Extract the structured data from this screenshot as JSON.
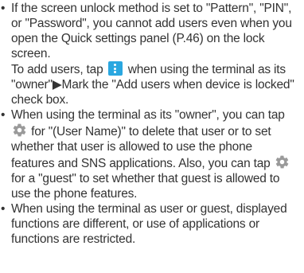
{
  "colors": {
    "text": "#333333",
    "menu_icon_bg": "#2aa7e0",
    "gear_icon": "#9a9a9a"
  },
  "bullets": [
    {
      "lines": [
        "If the screen unlock method is set to \"Pattern\", \"PIN\",",
        "or \"Password\", you cannot add users even when you",
        "open the Quick settings panel (P.46) on the lock",
        "screen."
      ],
      "line5_before": "To add users, tap",
      "line5_after": "when using the terminal as its",
      "lines_after": [
        "\"owner\"▶Mark the \"Add users when device is locked\"",
        "check box."
      ]
    },
    {
      "line1": "When using the terminal as its \"owner\", you can tap",
      "line2_after": "for \"(User Name)\" to delete that user or to set",
      "lines_mid": [
        "whether that user is allowed to use the phone",
        "features and SNS applications. Also, you can tap"
      ],
      "line5_after": "for a \"guest\" to set whether that guest is allowed to",
      "line6": "use the phone features."
    },
    {
      "lines": [
        "When using the terminal as  user or guest, displayed",
        "functions are different, or use of applications or",
        "functions are restricted."
      ]
    }
  ],
  "icons": {
    "menu": "menu-icon",
    "gear": "gear-icon"
  }
}
